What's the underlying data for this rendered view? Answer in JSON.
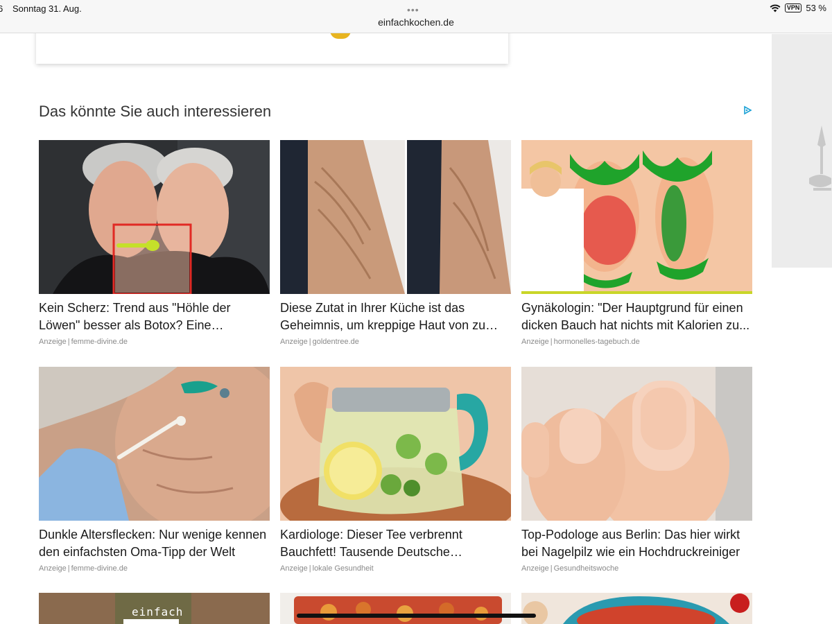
{
  "status_bar": {
    "time_fragment": "6",
    "date": "Sonntag 31. Aug.",
    "url": "einfachkochen.de",
    "vpn_label": "VPN",
    "battery": "53 %"
  },
  "section": {
    "title": "Das könnte Sie auch interessieren"
  },
  "colors": {
    "background": "#ffffff",
    "muted_text": "#8a8a8a",
    "adchoice": "#1aa1d6"
  },
  "articles": [
    {
      "title": "Kein Scherz: Trend aus \"Höhle der Löwen\" besser als Botox? Eine Anwendung red...",
      "ad_label": "Anzeige",
      "source": "femme-divine.de"
    },
    {
      "title": "Diese Zutat in Ihrer Küche ist das Geheimnis, um kreppige Haut von zu Hause...",
      "ad_label": "Anzeige",
      "source": "goldentree.de"
    },
    {
      "title": "Gynäkologin: \"Der Hauptgrund für einen dicken Bauch hat nichts mit Kalorien zu...",
      "ad_label": "Anzeige",
      "source": "hormonelles-tagebuch.de"
    },
    {
      "title": "Dunkle Altersflecken: Nur wenige kennen den einfachsten Oma-Tipp der Welt",
      "ad_label": "Anzeige",
      "source": "femme-divine.de"
    },
    {
      "title": "Kardiologe: Dieser Tee verbrennt Bauchfett! Tausende Deutsche begeistert!",
      "ad_label": "Anzeige",
      "source": "lokale Gesundheit"
    },
    {
      "title": "Top-Podologe aus Berlin: Das hier wirkt bei Nagelpilz wie ein Hochdruckreiniger",
      "ad_label": "Anzeige",
      "source": "Gesundheitswoche"
    }
  ],
  "partial_row": {
    "image_text": "einfach"
  }
}
